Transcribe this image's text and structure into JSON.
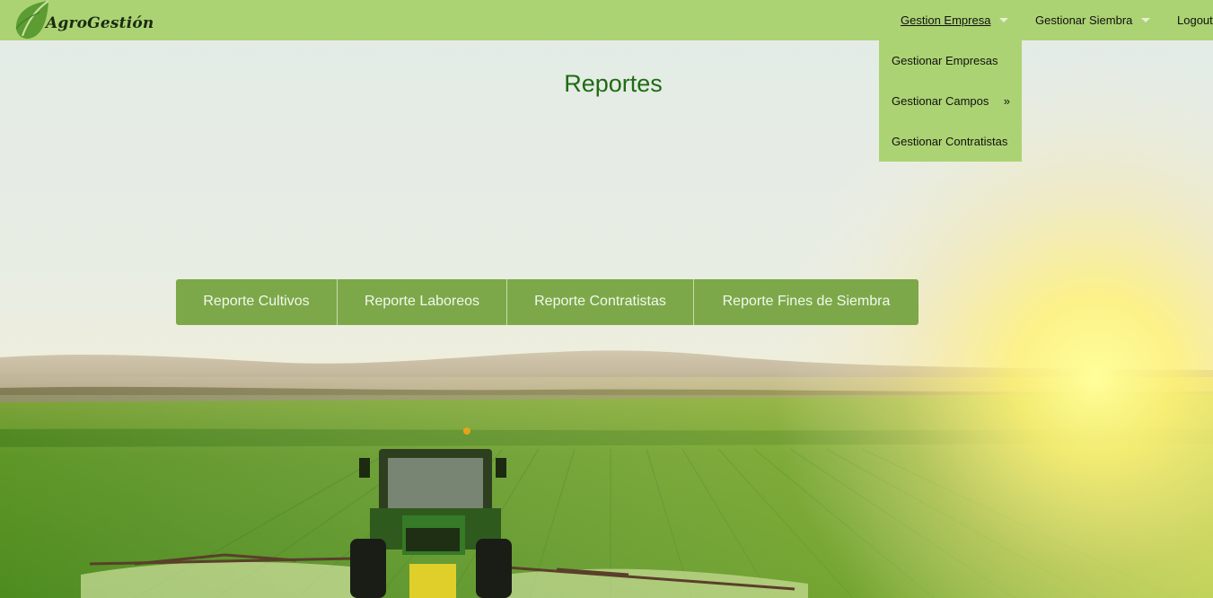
{
  "brand": {
    "name": "AgroGestión",
    "logo_icon": "leaf-icon"
  },
  "nav": {
    "items": [
      {
        "label": "Gestion Empresa",
        "has_dropdown": true,
        "active": true
      },
      {
        "label": "Gestionar Siembra",
        "has_dropdown": true,
        "active": false
      },
      {
        "label": "Logout",
        "has_dropdown": false,
        "active": false
      }
    ],
    "dropdown": {
      "items": [
        {
          "label": "Gestionar Empresas"
        },
        {
          "label": "Gestionar Campos",
          "submenu_arrow": "»"
        },
        {
          "label": "Gestionar Contratistas"
        }
      ]
    }
  },
  "main": {
    "title": "Reportes",
    "reports": [
      {
        "label": "Reporte Cultivos"
      },
      {
        "label": "Reporte Laboreos"
      },
      {
        "label": "Reporte Contratistas"
      },
      {
        "label": "Reporte Fines de Siembra"
      }
    ]
  },
  "colors": {
    "navbar": "#acd373",
    "title": "#1f6b12",
    "report_buttons": "#7ca84a"
  }
}
